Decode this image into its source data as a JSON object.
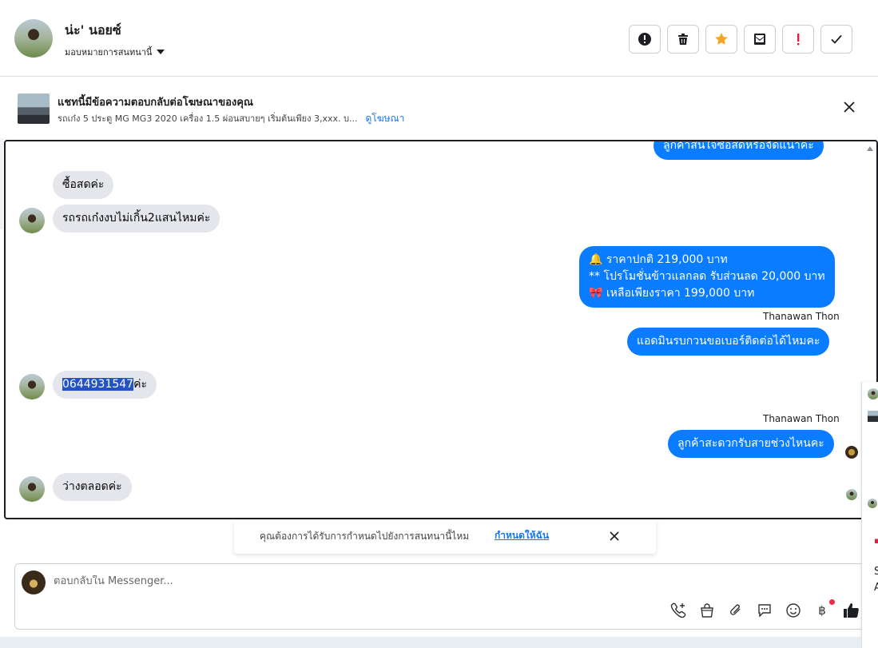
{
  "header": {
    "contact_name": "น่ะ' นอยซ์",
    "assign_label": "มอบหมายการสนทนานี้",
    "actions": [
      {
        "name": "report-spam",
        "icon": "alert-circle-icon"
      },
      {
        "name": "delete",
        "icon": "trash-icon"
      },
      {
        "name": "star",
        "icon": "star-icon",
        "color": "#f5a623"
      },
      {
        "name": "mark-unread",
        "icon": "mail-unread-icon"
      },
      {
        "name": "follow-up",
        "icon": "exclamation-icon",
        "color": "#e41e3f"
      },
      {
        "name": "mark-done",
        "icon": "checkmark-icon"
      }
    ]
  },
  "ad_banner": {
    "title": "แชทนี้มีข้อความตอบกลับต่อโฆษณาของคุณ",
    "description": "รถเก๋ง 5 ประตู MG MG3 2020 เครื่อง 1.5 ผ่อนสบายๆ เริ่มต้นเพียง 3,xxx. บ...",
    "link_label": "ดูโฆษณา"
  },
  "messages": {
    "partial_top": "ลูกค้าสนใจซื้อสดหรือจัดแนาคะ",
    "m1": "ซื้อสดค่ะ",
    "m2": "รถรถเก๋งงบไม่เกิ้น2แสนไหมค่ะ",
    "m3_line1": "ราคาปกติ 219,000 บาท",
    "m3_line2": "** โปรโมชั่นข้าวแลกลด รับส่วนลด 20,000 บาท",
    "m3_line3": " เหลือเพียงราคา 199,000 บาท",
    "sender1": "Thanawan Thon",
    "m4": "แอดมินรบกวนขอเบอร์ติดต่อได้ไหมคะ",
    "m5_selected": "0644931547",
    "m5_rest": "ค่ะ",
    "sender2": "Thanawan Thon",
    "m6": "ลูกค้าสะดวกรับสายช่วงไหนคะ",
    "m7": "ว่างตลอดค่ะ"
  },
  "toast": {
    "text": "คุณต้องการได้รับการกำหนดไปยังการสนทนานี้ไหม",
    "link_label": "กำหนดให้ฉัน"
  },
  "composer": {
    "placeholder": "ตอบกลับใน Messenger...",
    "tools": [
      "call-plus-icon",
      "shopping-bag-icon",
      "paperclip-icon",
      "saved-reply-icon",
      "emoji-icon",
      "baht-icon",
      "thumbs-up-icon"
    ],
    "baht_symbol": "฿"
  },
  "side_panel": {
    "fragments": [
      "S",
      "A"
    ]
  },
  "colors": {
    "accent": "#0a7cff",
    "link": "#1877f2",
    "incoming_bubble": "#e4e6eb",
    "highlight": "#2454c3"
  }
}
